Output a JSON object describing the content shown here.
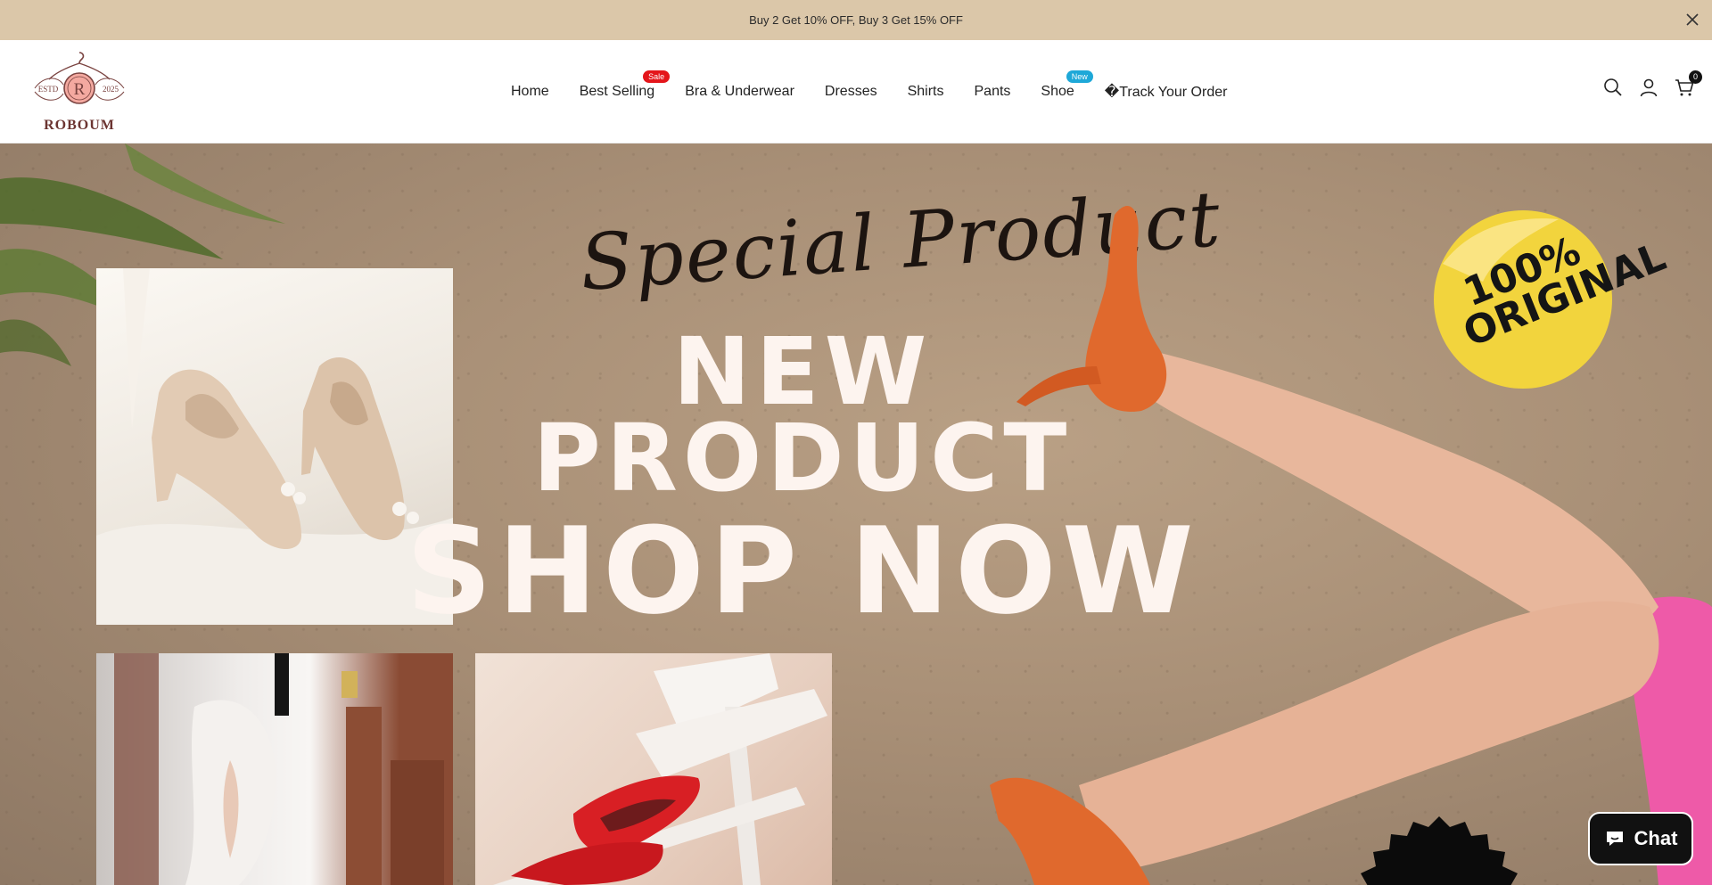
{
  "announcement": {
    "text": "Buy 2 Get 10% OFF, Buy 3 Get 15% OFF"
  },
  "logo": {
    "text": "ROBOUM",
    "initial": "R",
    "left_mark": "ESTD",
    "right_mark": "2025"
  },
  "nav": {
    "items": [
      {
        "label": "Home"
      },
      {
        "label": "Best Selling",
        "badge": "Sale"
      },
      {
        "label": "Bra & Underwear"
      },
      {
        "label": "Dresses"
      },
      {
        "label": "Shirts"
      },
      {
        "label": "Pants"
      },
      {
        "label": "Shoe",
        "badge": "New"
      },
      {
        "label": "�Track Your Order"
      }
    ]
  },
  "header": {
    "cart_count": "0"
  },
  "hero": {
    "script_title": "Special Product",
    "line1": "NEW",
    "line2": "PRODUCT",
    "line3": "SHOP NOW",
    "sticker_line1": "100%",
    "sticker_line2": "ORIGINAL"
  },
  "chat": {
    "label": "Chat"
  },
  "colors": {
    "announcement_bg": "#dbc7a9",
    "sale_badge": "#e4161b",
    "new_badge": "#1ea8d8",
    "sticker": "#f2d43d",
    "heel": "#e06a2e",
    "hero_text": "#fdf4ef"
  }
}
